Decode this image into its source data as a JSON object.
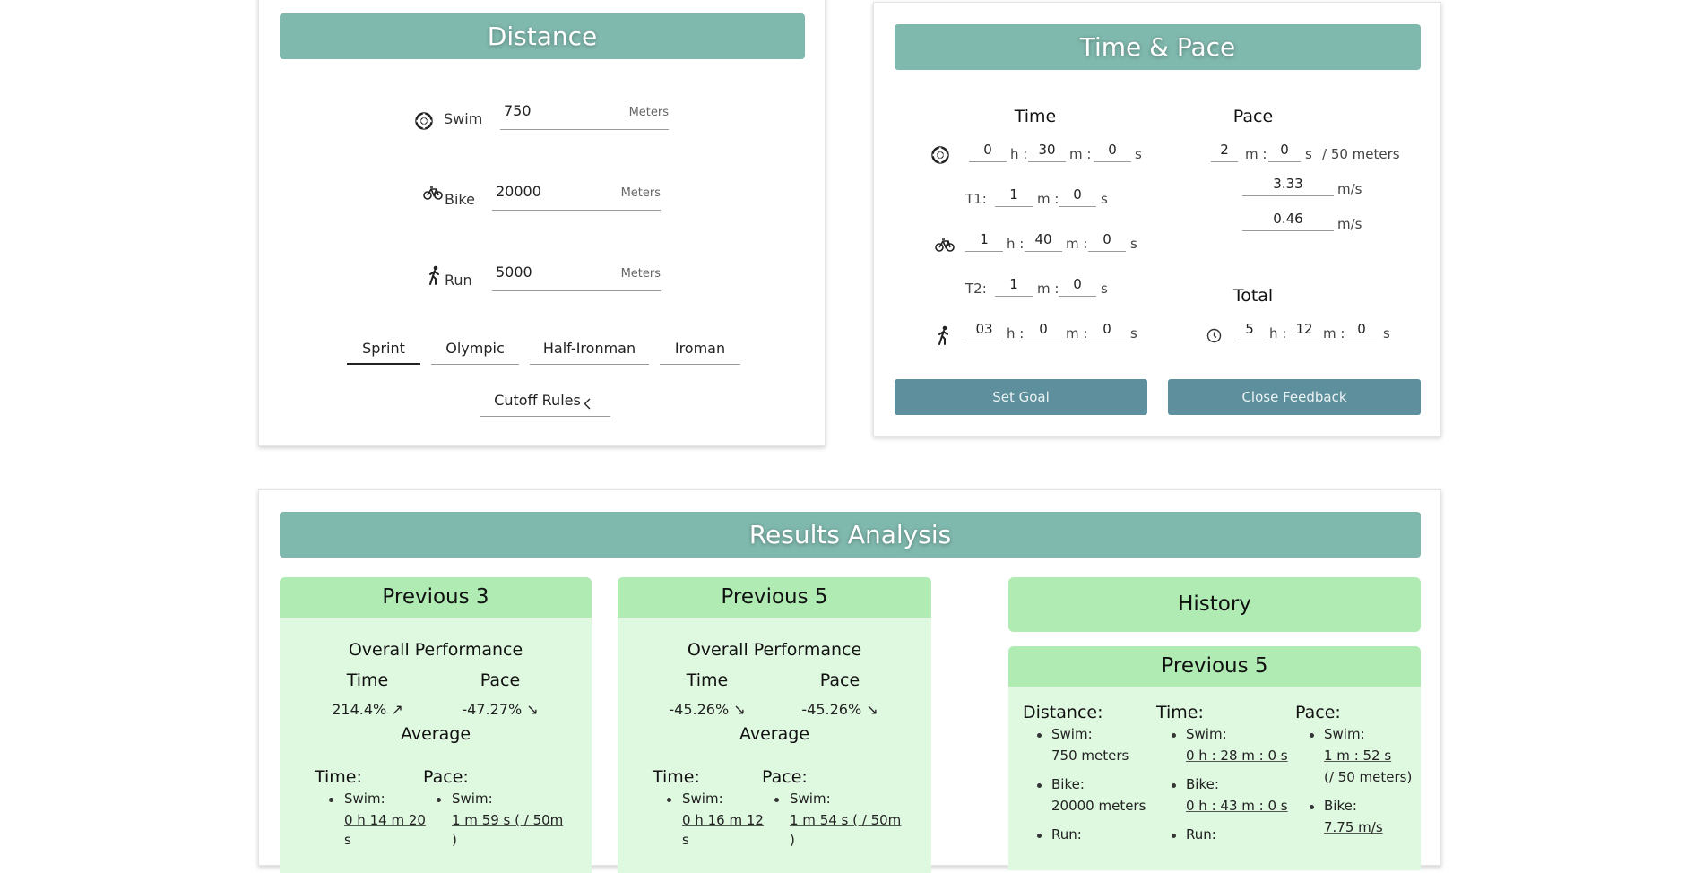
{
  "distance": {
    "title": "Distance",
    "swim": {
      "label": "Swim",
      "value": "750",
      "unit": "Meters"
    },
    "bike": {
      "label": "Bike",
      "value": "20000",
      "unit": "Meters"
    },
    "run": {
      "label": "Run",
      "value": "5000",
      "unit": "Meters"
    },
    "presets": [
      "Sprint",
      "Olympic",
      "Half-Ironman",
      "Iroman"
    ],
    "active_preset": "Sprint",
    "cutoff_label": "Cutoff Rules"
  },
  "time_pace": {
    "title": "Time & Pace",
    "time_header": "Time",
    "pace_header": "Pace",
    "total_header": "Total",
    "swim_time": {
      "h": "0",
      "m": "30",
      "s": "0"
    },
    "t1": {
      "label": "T1:",
      "m": "1",
      "s": "0"
    },
    "bike_time": {
      "h": "1",
      "m": "40",
      "s": "0"
    },
    "t2": {
      "label": "T2:",
      "m": "1",
      "s": "0"
    },
    "run_time": {
      "h": "03",
      "m": "0",
      "s": "0"
    },
    "swim_pace": {
      "m": "2",
      "s": "0",
      "unit": "/ 50 meters"
    },
    "bike_pace": {
      "value": "3.33",
      "unit": "m/s"
    },
    "run_pace": {
      "value": "0.46",
      "unit": "m/s"
    },
    "total": {
      "h": "5",
      "m": "12",
      "s": "0"
    },
    "units": {
      "h": "h :",
      "m": "m :",
      "s": "s"
    },
    "set_goal": "Set Goal",
    "close_feedback": "Close Feedback"
  },
  "results": {
    "title": "Results Analysis",
    "prev3": {
      "title": "Previous 3",
      "overall": "Overall Performance",
      "time_label": "Time",
      "pace_label": "Pace",
      "time_change": "214.4% ↗",
      "pace_change": "-47.27% ↘",
      "average": "Average",
      "avg_time_label": "Time:",
      "avg_pace_label": "Pace:",
      "swim_label": "Swim:",
      "swim_time_1": "0 h 14 m 20",
      "swim_time_2": "s",
      "swim_pace_1": "1 m 59 s ( / 50m",
      "swim_pace_2": ")"
    },
    "prev5": {
      "title": "Previous 5",
      "overall": "Overall Performance",
      "time_label": "Time",
      "pace_label": "Pace",
      "time_change": "-45.26% ↘",
      "pace_change": "-45.26% ↘",
      "average": "Average",
      "avg_time_label": "Time:",
      "avg_pace_label": "Pace:",
      "swim_label": "Swim:",
      "swim_time_1": "0 h 16 m 12",
      "swim_time_2": "s",
      "swim_pace_1": "1 m 54 s ( / 50m",
      "swim_pace_2": ")"
    },
    "history": {
      "title": "History",
      "sub_title": "Previous 5",
      "distance_label": "Distance:",
      "time_label": "Time:",
      "pace_label": "Pace:",
      "dist_swim_label": "Swim:",
      "dist_swim_value": "750 meters",
      "dist_bike_label": "Bike:",
      "dist_bike_value": "20000 meters",
      "dist_run_label": "Run:",
      "time_swim_label": "Swim:",
      "time_swim_value": "0 h : 28 m : 0 s",
      "time_bike_label": "Bike:",
      "time_bike_value": "0 h : 43 m : 0 s",
      "time_run_label": "Run:",
      "pace_swim_label": "Swim:",
      "pace_swim_value": "1 m : 52 s",
      "pace_swim_unit": "(/ 50 meters)",
      "pace_bike_label": "Bike:",
      "pace_bike_value": "7.75 m/s"
    }
  }
}
